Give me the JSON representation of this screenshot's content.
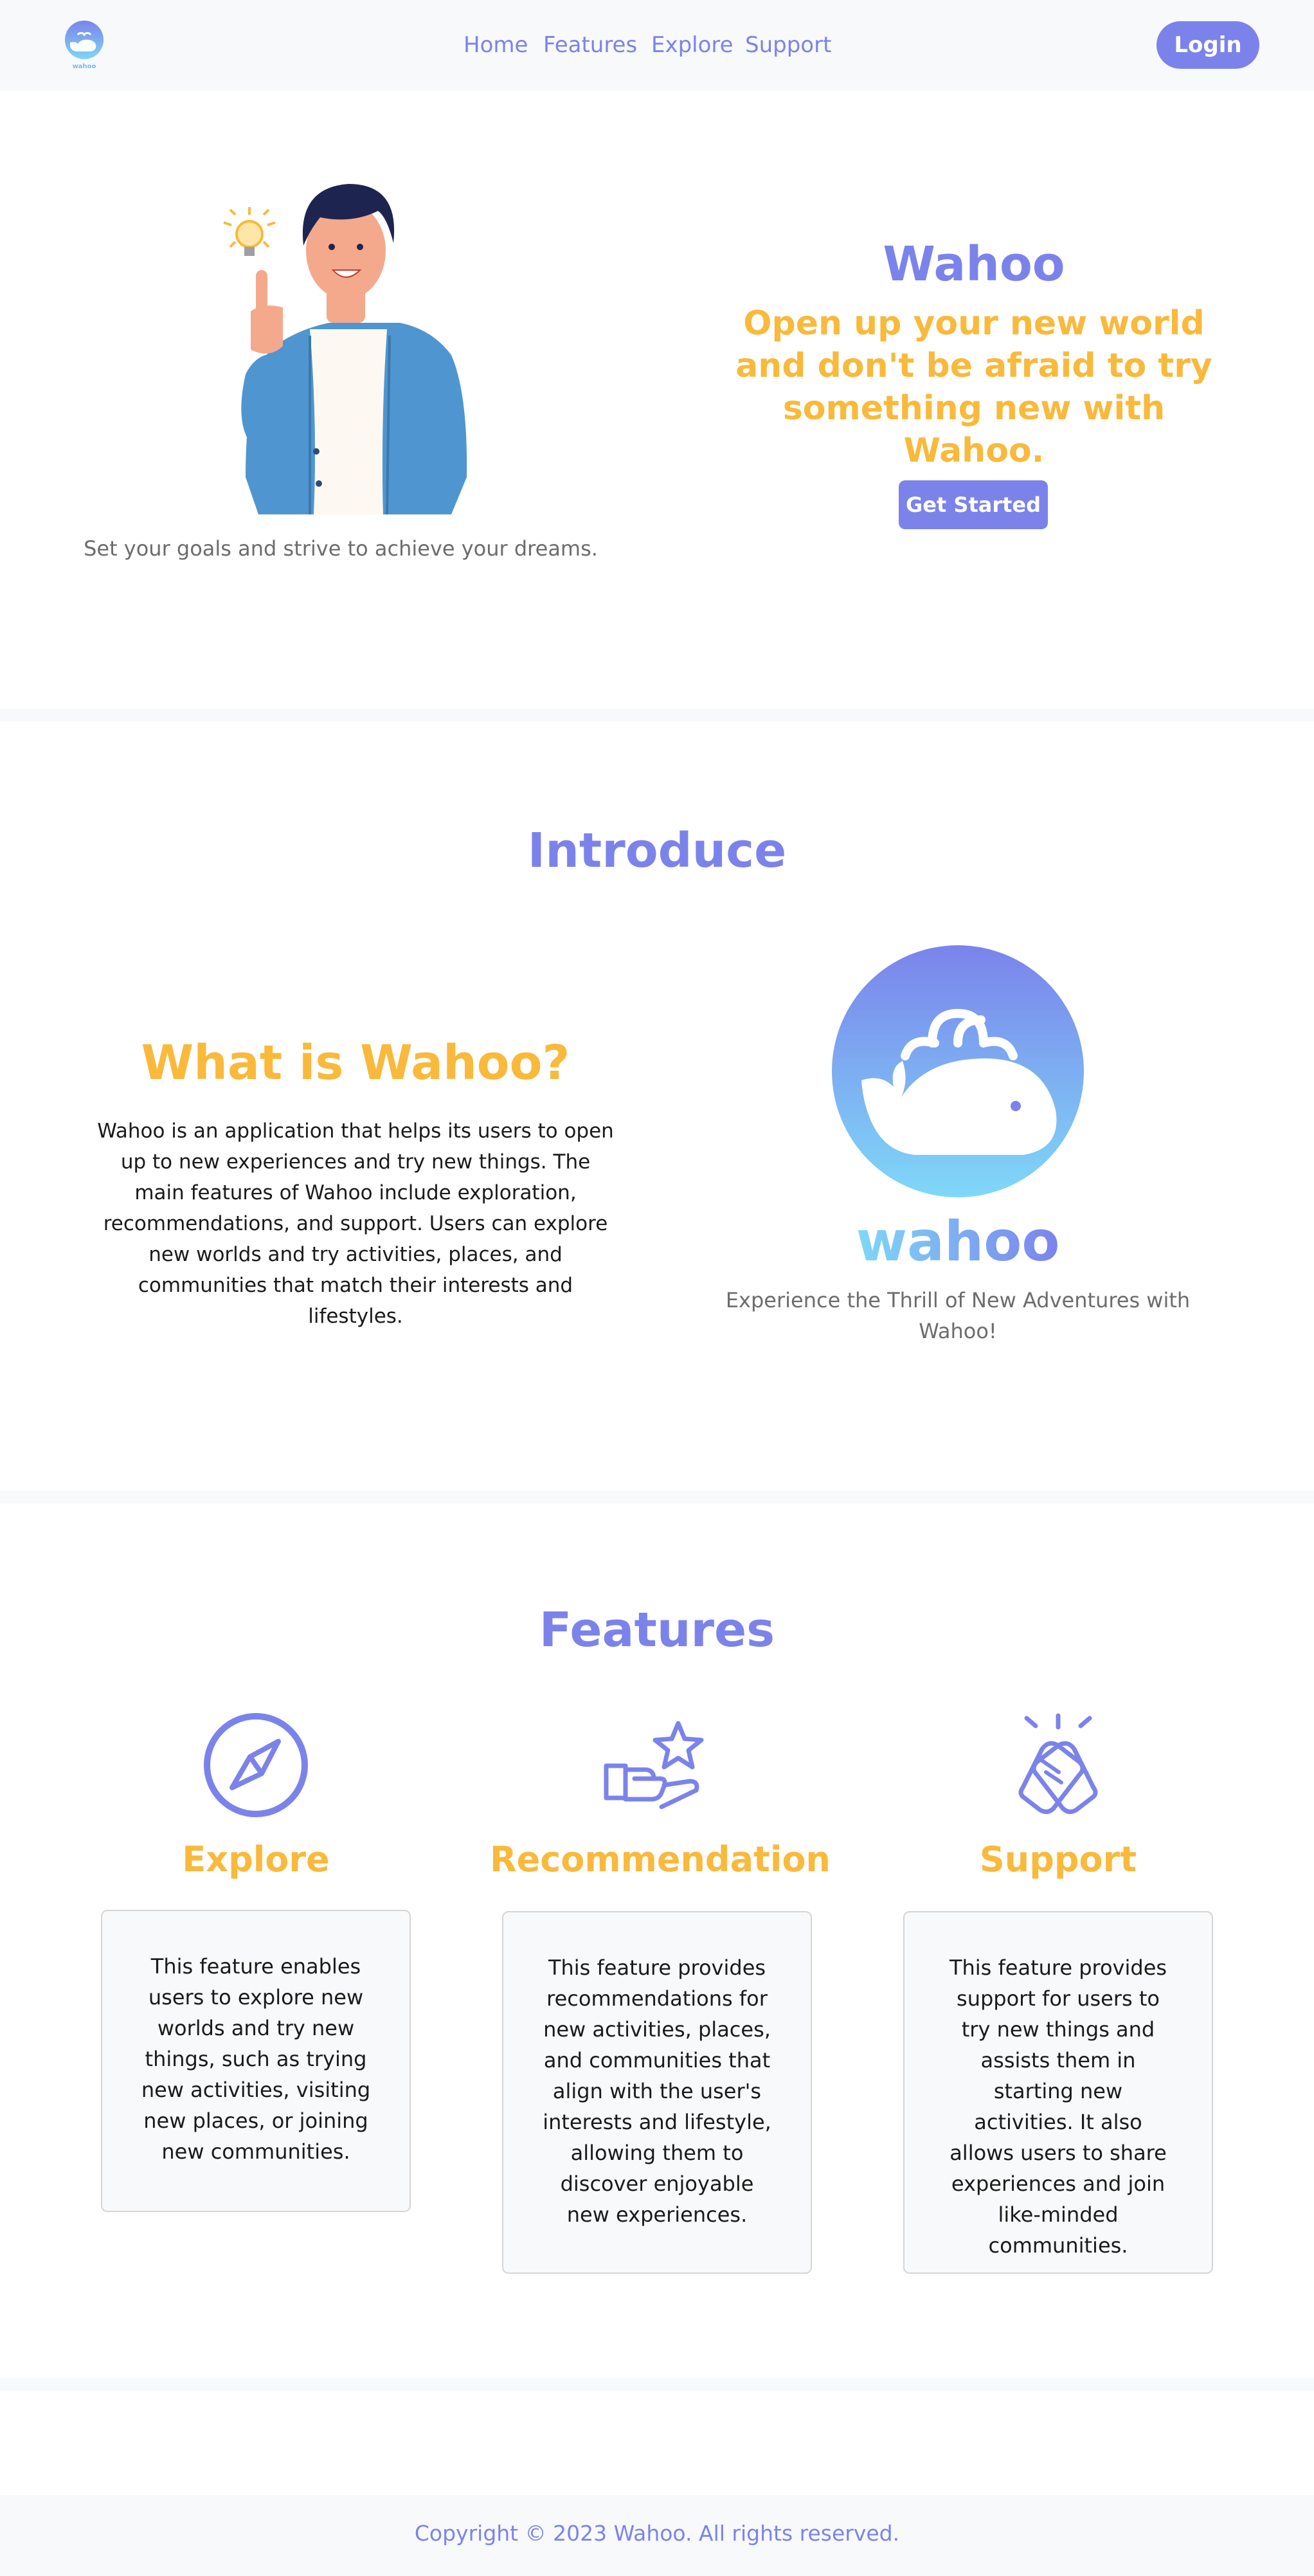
{
  "header": {
    "logo_text": "wahoo",
    "nav": [
      {
        "label": "Home"
      },
      {
        "label": "Features"
      },
      {
        "label": "Explore"
      },
      {
        "label": "Support"
      }
    ],
    "login_label": "Login"
  },
  "hero": {
    "title": "Wahoo",
    "tagline": "Open up your new world and don't be afraid to try something new with Wahoo.",
    "button_label": "Get Started",
    "caption": "Set your goals and strive to achieve your dreams."
  },
  "introduce": {
    "heading": "Introduce",
    "what_heading": "What is Wahoo?",
    "body": "Wahoo is an application that helps its users to open up to new experiences and try new things. The main features of Wahoo include exploration, recommendations, and support. Users can explore new worlds and try activities, places, and communities that match their interests and lifestyles.",
    "logo_text": "wahoo",
    "caption": "Experience the Thrill of New Adventures with Wahoo!"
  },
  "features": {
    "heading": "Features",
    "items": [
      {
        "title": "Explore",
        "icon": "compass-icon",
        "text": "This feature enables users to explore new worlds and try new things, such as trying new activities, visiting new places, or joining new communities."
      },
      {
        "title": "Recommendation",
        "icon": "hand-star-icon",
        "text": "This feature provides recommendations for new activities, places, and communities that align with the user's interests and lifestyle, allowing them to discover enjoyable new experiences."
      },
      {
        "title": "Support",
        "icon": "high-five-icon",
        "text": "This feature provides support for users to try new things and assists them in starting new activities. It also allows users to share experiences and join like-minded communities."
      }
    ]
  },
  "footer": {
    "copyright": "Copyright © 2023 Wahoo. All rights reserved."
  },
  "colors": {
    "primary": "#7b83eb",
    "accent": "#f9b93b",
    "gray_bg": "#f8f9fa"
  }
}
